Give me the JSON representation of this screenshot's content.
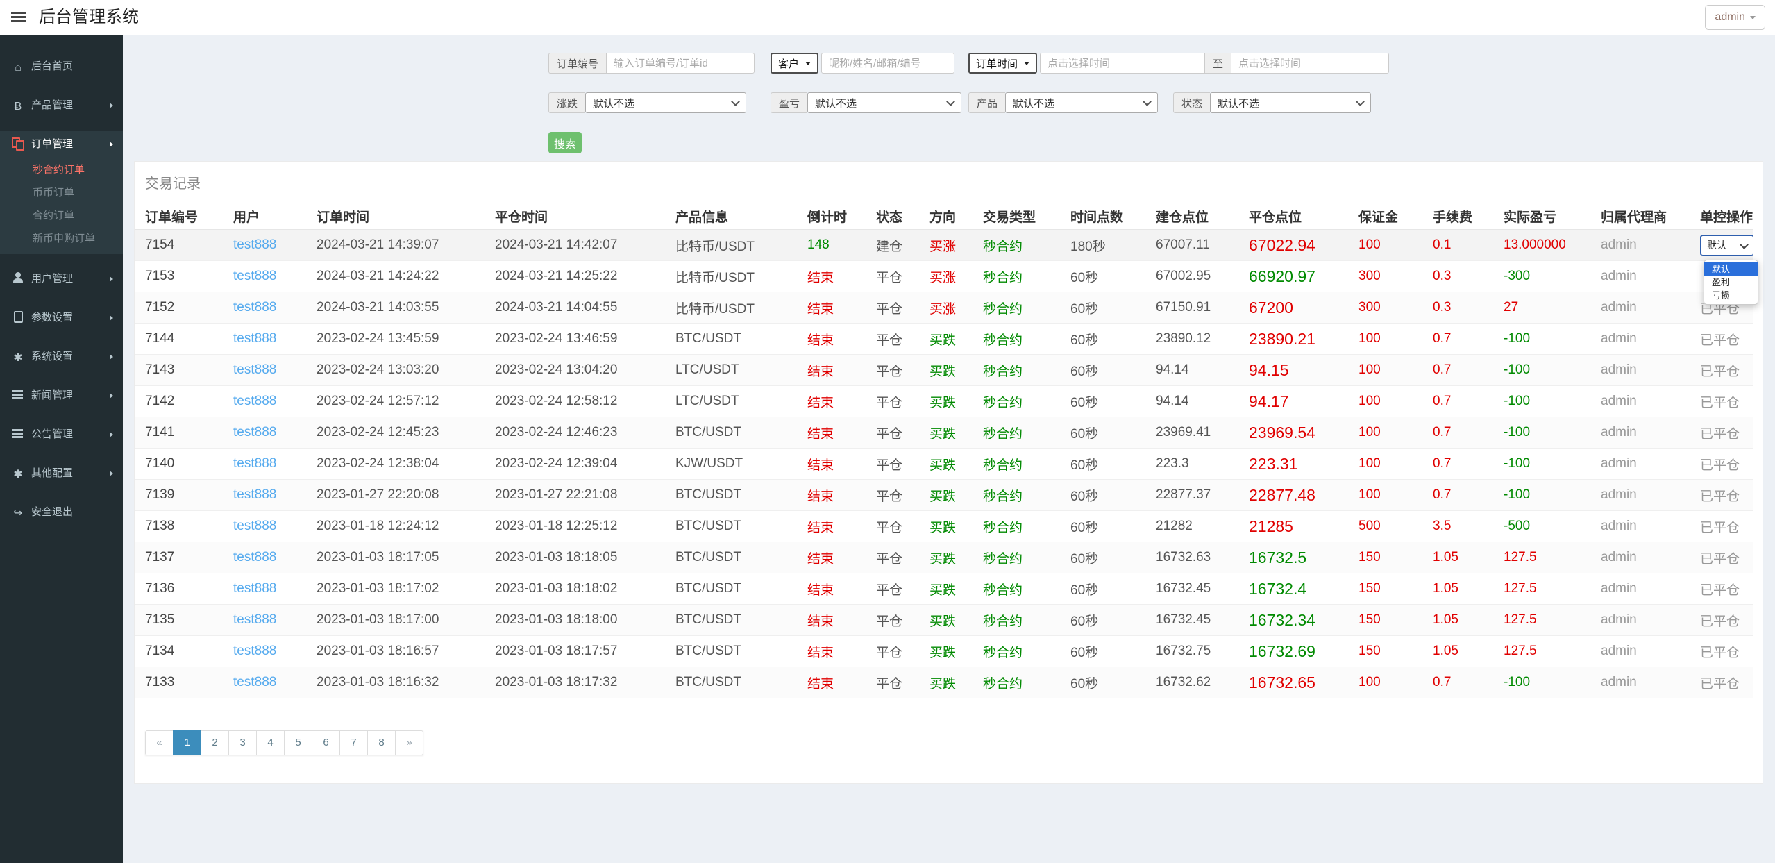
{
  "app": {
    "title": "后台管理系统",
    "user": "admin"
  },
  "sidebar": {
    "items": [
      {
        "label": "后台首页",
        "icon": "home-icon"
      },
      {
        "label": "产品管理",
        "icon": "bitcoin-icon",
        "arrow": true
      },
      {
        "label": "订单管理",
        "icon": "orders-icon",
        "arrow": true,
        "open": true,
        "children": [
          {
            "label": "秒合约订单",
            "active": true
          },
          {
            "label": "币币订单"
          },
          {
            "label": "合约订单"
          },
          {
            "label": "新币申购订单"
          }
        ]
      },
      {
        "label": "用户管理",
        "icon": "user-icon",
        "arrow": true
      },
      {
        "label": "参数设置",
        "icon": "doc-icon",
        "arrow": true
      },
      {
        "label": "系统设置",
        "icon": "gears-icon",
        "arrow": true
      },
      {
        "label": "新闻管理",
        "icon": "list-icon",
        "arrow": true
      },
      {
        "label": "公告管理",
        "icon": "list-icon",
        "arrow": true
      },
      {
        "label": "其他配置",
        "icon": "gear-icon",
        "arrow": true
      },
      {
        "label": "安全退出",
        "icon": "logout-icon"
      }
    ]
  },
  "filters": {
    "order_no_label": "订单编号",
    "order_no_placeholder": "输入订单编号/订单id",
    "customer_select": "客户",
    "customer_placeholder": "昵称/姓名/邮箱/编号",
    "time_select": "订单时间",
    "time_from_placeholder": "点击选择时间",
    "to_label": "至",
    "time_to_placeholder": "点击选择时间",
    "updown_label": "涨跌",
    "updown_value": "默认不选",
    "pnl_label": "盈亏",
    "pnl_value": "默认不选",
    "product_label": "产品",
    "product_value": "默认不选",
    "status_label": "状态",
    "status_value": "默认不选",
    "search_button": "搜索"
  },
  "panel": {
    "title": "交易记录",
    "columns": [
      "订单编号",
      "用户",
      "订单时间",
      "平仓时间",
      "产品信息",
      "倒计时",
      "状态",
      "方向",
      "交易类型",
      "时间点数",
      "建仓点位",
      "平仓点位",
      "保证金",
      "手续费",
      "实际盈亏",
      "归属代理商",
      "单控操作"
    ],
    "rows": [
      [
        "7154",
        "test888",
        "2024-03-21 14:39:07",
        "2024-03-21 14:42:07",
        "比特币/USDT",
        {
          "t": "148",
          "c": "green"
        },
        "建仓",
        {
          "t": "买涨",
          "c": "red"
        },
        {
          "t": "秒合约",
          "c": "green"
        },
        "180秒",
        "67007.11",
        {
          "t": "67022.94",
          "c": "red"
        },
        {
          "t": "100",
          "c": "red"
        },
        {
          "t": "0.1",
          "c": "red"
        },
        {
          "t": "13.000000",
          "c": "red"
        },
        "admin",
        {
          "control": "select"
        }
      ],
      [
        "7153",
        "test888",
        "2024-03-21 14:24:22",
        "2024-03-21 14:25:22",
        "比特币/USDT",
        {
          "t": "结束",
          "c": "red"
        },
        "平仓",
        {
          "t": "买涨",
          "c": "red"
        },
        {
          "t": "秒合约",
          "c": "green"
        },
        "60秒",
        "67002.95",
        {
          "t": "66920.97",
          "c": "green"
        },
        {
          "t": "300",
          "c": "red"
        },
        {
          "t": "0.3",
          "c": "red"
        },
        {
          "t": "-300",
          "c": "green"
        },
        "admin",
        {
          "t": "",
          "c": "muted"
        }
      ],
      [
        "7152",
        "test888",
        "2024-03-21 14:03:55",
        "2024-03-21 14:04:55",
        "比特币/USDT",
        {
          "t": "结束",
          "c": "red"
        },
        "平仓",
        {
          "t": "买涨",
          "c": "red"
        },
        {
          "t": "秒合约",
          "c": "green"
        },
        "60秒",
        "67150.91",
        {
          "t": "67200",
          "c": "red"
        },
        {
          "t": "300",
          "c": "red"
        },
        {
          "t": "0.3",
          "c": "red"
        },
        {
          "t": "27",
          "c": "red"
        },
        "admin",
        {
          "t": "已平仓",
          "c": "muted"
        }
      ],
      [
        "7144",
        "test888",
        "2023-02-24 13:45:59",
        "2023-02-24 13:46:59",
        "BTC/USDT",
        {
          "t": "结束",
          "c": "red"
        },
        "平仓",
        {
          "t": "买跌",
          "c": "green"
        },
        {
          "t": "秒合约",
          "c": "green"
        },
        "60秒",
        "23890.12",
        {
          "t": "23890.21",
          "c": "red"
        },
        {
          "t": "100",
          "c": "red"
        },
        {
          "t": "0.7",
          "c": "red"
        },
        {
          "t": "-100",
          "c": "green"
        },
        "admin",
        {
          "t": "已平仓",
          "c": "muted"
        }
      ],
      [
        "7143",
        "test888",
        "2023-02-24 13:03:20",
        "2023-02-24 13:04:20",
        "LTC/USDT",
        {
          "t": "结束",
          "c": "red"
        },
        "平仓",
        {
          "t": "买跌",
          "c": "green"
        },
        {
          "t": "秒合约",
          "c": "green"
        },
        "60秒",
        "94.14",
        {
          "t": "94.15",
          "c": "red"
        },
        {
          "t": "100",
          "c": "red"
        },
        {
          "t": "0.7",
          "c": "red"
        },
        {
          "t": "-100",
          "c": "green"
        },
        "admin",
        {
          "t": "已平仓",
          "c": "muted"
        }
      ],
      [
        "7142",
        "test888",
        "2023-02-24 12:57:12",
        "2023-02-24 12:58:12",
        "LTC/USDT",
        {
          "t": "结束",
          "c": "red"
        },
        "平仓",
        {
          "t": "买跌",
          "c": "green"
        },
        {
          "t": "秒合约",
          "c": "green"
        },
        "60秒",
        "94.14",
        {
          "t": "94.17",
          "c": "red"
        },
        {
          "t": "100",
          "c": "red"
        },
        {
          "t": "0.7",
          "c": "red"
        },
        {
          "t": "-100",
          "c": "green"
        },
        "admin",
        {
          "t": "已平仓",
          "c": "muted"
        }
      ],
      [
        "7141",
        "test888",
        "2023-02-24 12:45:23",
        "2023-02-24 12:46:23",
        "BTC/USDT",
        {
          "t": "结束",
          "c": "red"
        },
        "平仓",
        {
          "t": "买跌",
          "c": "green"
        },
        {
          "t": "秒合约",
          "c": "green"
        },
        "60秒",
        "23969.41",
        {
          "t": "23969.54",
          "c": "red"
        },
        {
          "t": "100",
          "c": "red"
        },
        {
          "t": "0.7",
          "c": "red"
        },
        {
          "t": "-100",
          "c": "green"
        },
        "admin",
        {
          "t": "已平仓",
          "c": "muted"
        }
      ],
      [
        "7140",
        "test888",
        "2023-02-24 12:38:04",
        "2023-02-24 12:39:04",
        "KJW/USDT",
        {
          "t": "结束",
          "c": "red"
        },
        "平仓",
        {
          "t": "买跌",
          "c": "green"
        },
        {
          "t": "秒合约",
          "c": "green"
        },
        "60秒",
        "223.3",
        {
          "t": "223.31",
          "c": "red"
        },
        {
          "t": "100",
          "c": "red"
        },
        {
          "t": "0.7",
          "c": "red"
        },
        {
          "t": "-100",
          "c": "green"
        },
        "admin",
        {
          "t": "已平仓",
          "c": "muted"
        }
      ],
      [
        "7139",
        "test888",
        "2023-01-27 22:20:08",
        "2023-01-27 22:21:08",
        "BTC/USDT",
        {
          "t": "结束",
          "c": "red"
        },
        "平仓",
        {
          "t": "买跌",
          "c": "green"
        },
        {
          "t": "秒合约",
          "c": "green"
        },
        "60秒",
        "22877.37",
        {
          "t": "22877.48",
          "c": "red"
        },
        {
          "t": "100",
          "c": "red"
        },
        {
          "t": "0.7",
          "c": "red"
        },
        {
          "t": "-100",
          "c": "green"
        },
        "admin",
        {
          "t": "已平仓",
          "c": "muted"
        }
      ],
      [
        "7138",
        "test888",
        "2023-01-18 12:24:12",
        "2023-01-18 12:25:12",
        "BTC/USDT",
        {
          "t": "结束",
          "c": "red"
        },
        "平仓",
        {
          "t": "买跌",
          "c": "green"
        },
        {
          "t": "秒合约",
          "c": "green"
        },
        "60秒",
        "21282",
        {
          "t": "21285",
          "c": "red"
        },
        {
          "t": "500",
          "c": "red"
        },
        {
          "t": "3.5",
          "c": "red"
        },
        {
          "t": "-500",
          "c": "green"
        },
        "admin",
        {
          "t": "已平仓",
          "c": "muted"
        }
      ],
      [
        "7137",
        "test888",
        "2023-01-03 18:17:05",
        "2023-01-03 18:18:05",
        "BTC/USDT",
        {
          "t": "结束",
          "c": "red"
        },
        "平仓",
        {
          "t": "买跌",
          "c": "green"
        },
        {
          "t": "秒合约",
          "c": "green"
        },
        "60秒",
        "16732.63",
        {
          "t": "16732.5",
          "c": "green"
        },
        {
          "t": "150",
          "c": "red"
        },
        {
          "t": "1.05",
          "c": "red"
        },
        {
          "t": "127.5",
          "c": "red"
        },
        "admin",
        {
          "t": "已平仓",
          "c": "muted"
        }
      ],
      [
        "7136",
        "test888",
        "2023-01-03 18:17:02",
        "2023-01-03 18:18:02",
        "BTC/USDT",
        {
          "t": "结束",
          "c": "red"
        },
        "平仓",
        {
          "t": "买跌",
          "c": "green"
        },
        {
          "t": "秒合约",
          "c": "green"
        },
        "60秒",
        "16732.45",
        {
          "t": "16732.4",
          "c": "green"
        },
        {
          "t": "150",
          "c": "red"
        },
        {
          "t": "1.05",
          "c": "red"
        },
        {
          "t": "127.5",
          "c": "red"
        },
        "admin",
        {
          "t": "已平仓",
          "c": "muted"
        }
      ],
      [
        "7135",
        "test888",
        "2023-01-03 18:17:00",
        "2023-01-03 18:18:00",
        "BTC/USDT",
        {
          "t": "结束",
          "c": "red"
        },
        "平仓",
        {
          "t": "买跌",
          "c": "green"
        },
        {
          "t": "秒合约",
          "c": "green"
        },
        "60秒",
        "16732.45",
        {
          "t": "16732.34",
          "c": "green"
        },
        {
          "t": "150",
          "c": "red"
        },
        {
          "t": "1.05",
          "c": "red"
        },
        {
          "t": "127.5",
          "c": "red"
        },
        "admin",
        {
          "t": "已平仓",
          "c": "muted"
        }
      ],
      [
        "7134",
        "test888",
        "2023-01-03 18:16:57",
        "2023-01-03 18:17:57",
        "BTC/USDT",
        {
          "t": "结束",
          "c": "red"
        },
        "平仓",
        {
          "t": "买跌",
          "c": "green"
        },
        {
          "t": "秒合约",
          "c": "green"
        },
        "60秒",
        "16732.75",
        {
          "t": "16732.69",
          "c": "green"
        },
        {
          "t": "150",
          "c": "red"
        },
        {
          "t": "1.05",
          "c": "red"
        },
        {
          "t": "127.5",
          "c": "red"
        },
        "admin",
        {
          "t": "已平仓",
          "c": "muted"
        }
      ],
      [
        "7133",
        "test888",
        "2023-01-03 18:16:32",
        "2023-01-03 18:17:32",
        "BTC/USDT",
        {
          "t": "结束",
          "c": "red"
        },
        "平仓",
        {
          "t": "买跌",
          "c": "green"
        },
        {
          "t": "秒合约",
          "c": "green"
        },
        "60秒",
        "16732.62",
        {
          "t": "16732.65",
          "c": "red"
        },
        {
          "t": "100",
          "c": "red"
        },
        {
          "t": "0.7",
          "c": "red"
        },
        {
          "t": "-100",
          "c": "green"
        },
        "admin",
        {
          "t": "已平仓",
          "c": "muted"
        }
      ]
    ],
    "control_dropdown": {
      "value": "默认",
      "options": [
        "默认",
        "盈利",
        "亏损"
      ],
      "selected_index": 0
    }
  },
  "pagination": {
    "prev": "«",
    "pages": [
      "1",
      "2",
      "3",
      "4",
      "5",
      "6",
      "7",
      "8"
    ],
    "active_page": "1",
    "next": "»"
  },
  "colors": {
    "accent_red": "#e8594f",
    "link_blue": "#55aaee",
    "up_red": "#e00000",
    "down_green": "#018a01",
    "primary_blue": "#3c8dbc",
    "button_green": "#6ec06e",
    "dropdown_highlight": "#2a6fdb"
  }
}
